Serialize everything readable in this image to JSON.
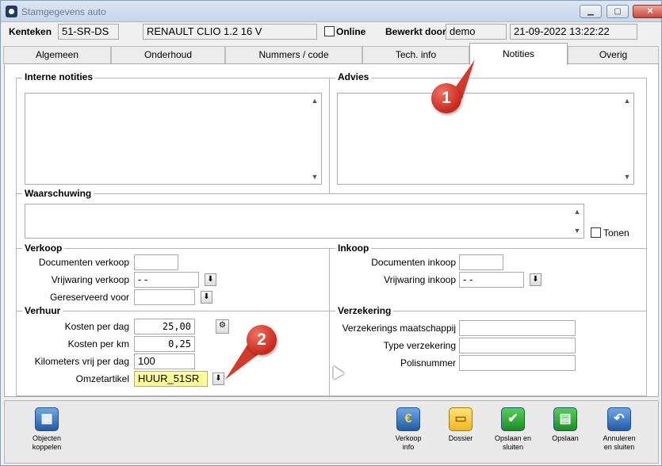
{
  "window": {
    "title": "Stamgegevens auto"
  },
  "header": {
    "kenteken_label": "Kenteken",
    "kenteken_value": "51-SR-DS",
    "model_value": "RENAULT CLIO 1.2 16 V",
    "online_label": "Online",
    "bewerkt_door_label": "Bewerkt door",
    "bewerkt_door_value": "demo",
    "timestamp_value": "21-09-2022 13:22:22"
  },
  "tabs": [
    {
      "label": "Algemeen",
      "active": false
    },
    {
      "label": "Onderhoud",
      "active": false
    },
    {
      "label": "Nummers / code",
      "active": false
    },
    {
      "label": "Tech. info",
      "active": false
    },
    {
      "label": "Notities",
      "active": true
    },
    {
      "label": "Overig",
      "active": false
    }
  ],
  "notities": {
    "interne_notities_title": "Interne notities",
    "advies_title": "Advies",
    "waarschuwing_title": "Waarschuwing",
    "tonen_label": "Tonen"
  },
  "verkoop": {
    "title": "Verkoop",
    "documenten_label": "Documenten verkoop",
    "documenten_value": "",
    "vrijwaring_label": "Vrijwaring verkoop",
    "vrijwaring_value": "  -  -",
    "gereserveerd_label": "Gereserveerd voor",
    "gereserveerd_value": ""
  },
  "inkoop": {
    "title": "Inkoop",
    "documenten_label": "Documenten inkoop",
    "documenten_value": "",
    "vrijwaring_label": "Vrijwaring inkoop",
    "vrijwaring_value": "  -  -"
  },
  "verhuur": {
    "title": "Verhuur",
    "kosten_dag_label": "Kosten per dag",
    "kosten_dag_value": "25,00",
    "kosten_km_label": "Kosten per km",
    "kosten_km_value": "0,25",
    "km_vrij_label": "Kilometers vrij per dag",
    "km_vrij_value": "100",
    "omzet_label": "Omzetartikel",
    "omzet_value": "HUUR_51SR"
  },
  "verzekering": {
    "title": "Verzekering",
    "maatschappij_label": "Verzekerings maatschappij",
    "maatschappij_value": "",
    "type_label": "Type verzekering",
    "type_value": "",
    "polis_label": "Polisnummer",
    "polis_value": ""
  },
  "annotations": {
    "one": "1",
    "two": "2"
  },
  "footer": {
    "objecten_label_1": "Objecten",
    "objecten_label_2": "koppelen",
    "verkoop_info_1": "Verkoop",
    "verkoop_info_2": "info",
    "dossier": "Dossier",
    "opslaan_sluiten_1": "Opslaan en",
    "opslaan_sluiten_2": "sluiten",
    "opslaan": "Opslaan",
    "annuleren_1": "Annuleren",
    "annuleren_2": "en sluiten"
  },
  "icons": {
    "app": "app-icon",
    "objecten": "objecten-koppelen-icon",
    "verkoop": "euro-coin-icon",
    "dossier": "folder-icon",
    "opslaan_sluiten": "check-icon",
    "opslaan": "floppy-disk-icon",
    "annuleren": "undo-arrow-icon"
  }
}
